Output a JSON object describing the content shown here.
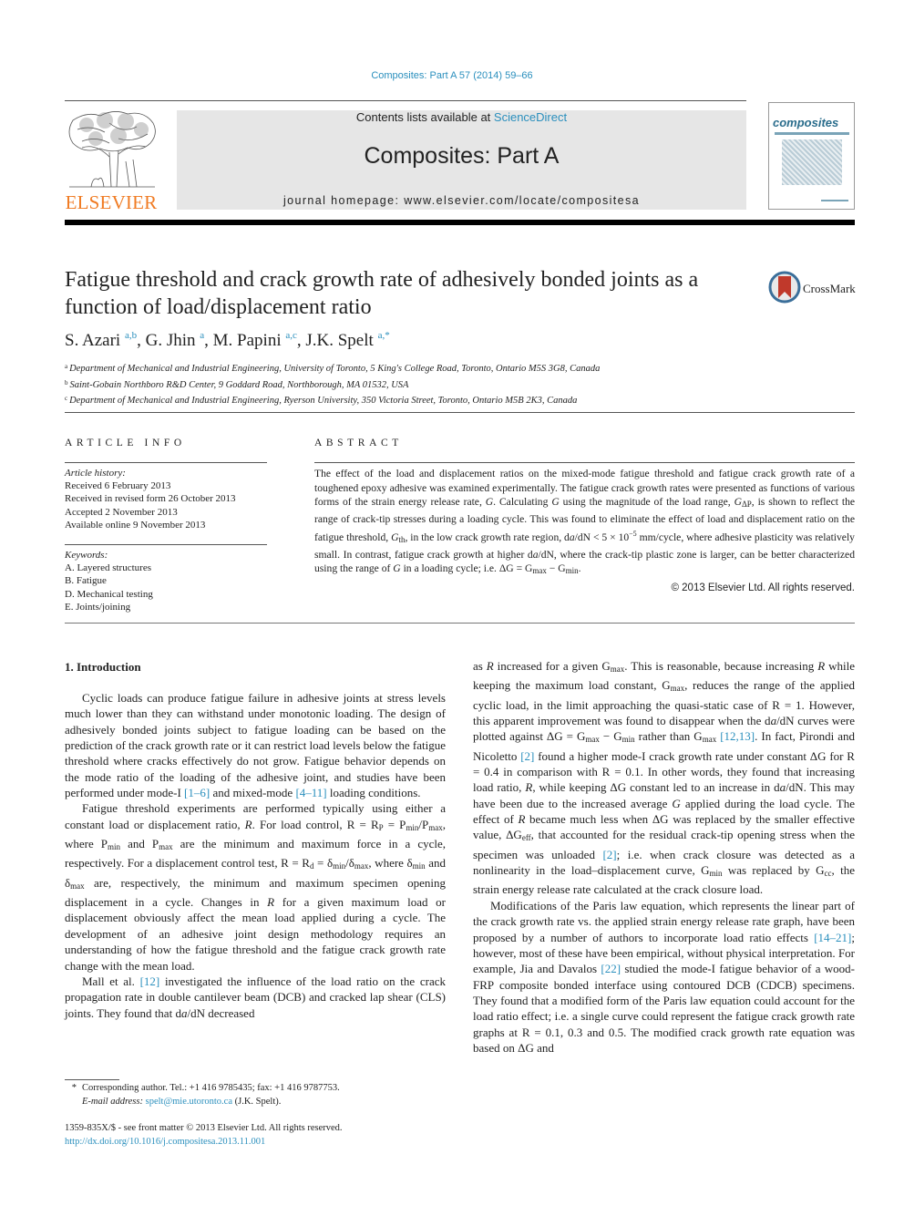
{
  "header": {
    "citation": "Composites: Part A 57 (2014) 59–66",
    "contents_prefix": "Contents lists available at ",
    "contents_link": "ScienceDirect",
    "journal_name": "Composites: Part A",
    "homepage": "journal homepage: www.elsevier.com/locate/compositesa",
    "publisher_logo_text": "ELSEVIER",
    "cover_title": "composites",
    "colors": {
      "link": "#2a8fbd",
      "elsevier_orange": "#f07b23",
      "masthead_bg": "#e6e6e6"
    }
  },
  "article": {
    "title": "Fatigue threshold and crack growth rate of adhesively bonded joints as a function of load/displacement ratio",
    "crossmark_label": "CrossMark",
    "authors": [
      {
        "name": "S. Azari",
        "affil": "a,b"
      },
      {
        "name": "G. Jhin",
        "affil": "a"
      },
      {
        "name": "M. Papini",
        "affil": "a,c"
      },
      {
        "name": "J.K. Spelt",
        "affil": "a,*"
      }
    ],
    "affiliations": [
      {
        "key": "a",
        "text": "Department of Mechanical and Industrial Engineering, University of Toronto, 5 King's College Road, Toronto, Ontario M5S 3G8, Canada"
      },
      {
        "key": "b",
        "text": "Saint-Gobain Northboro R&D Center, 9 Goddard Road, Northborough, MA 01532, USA"
      },
      {
        "key": "c",
        "text": "Department of Mechanical and Industrial Engineering, Ryerson University, 350 Victoria Street, Toronto, Ontario M5B 2K3, Canada"
      }
    ]
  },
  "article_info": {
    "heading": "ARTICLE INFO",
    "history_label": "Article history:",
    "history": [
      "Received 6 February 2013",
      "Received in revised form 26 October 2013",
      "Accepted 2 November 2013",
      "Available online 9 November 2013"
    ],
    "keywords_label": "Keywords:",
    "keywords": [
      "A. Layered structures",
      "B. Fatigue",
      "D. Mechanical testing",
      "E. Joints/joining"
    ]
  },
  "abstract": {
    "heading": "ABSTRACT",
    "s1": "The effect of the load and displacement ratios on the mixed-mode fatigue threshold and fatigue crack growth rate of a toughened epoxy adhesive was examined experimentally. The fatigue crack growth rates were presented as functions of various forms of the strain energy release rate, ",
    "s2": ". Calculating ",
    "s3": " using the magnitude of the load range, ",
    "s4": ", is shown to reflect the range of crack-tip stresses during a loading cycle. This was found to eliminate the effect of load and displacement ratio on the fatigue threshold, ",
    "s5": ", in the low crack growth rate region, d",
    "s6": " < 5 × 10",
    "exp": "−5",
    "s7": " mm/cycle, where adhesive plasticity was relatively small. In contrast, fatigue crack growth at higher d",
    "s8": ", where the crack-tip plastic zone is larger, can be better characterized using the range of ",
    "s9": " in a loading cycle; i.e. ΔG = G",
    "s10": " − G",
    "copyright": "© 2013 Elsevier Ltd. All rights reserved."
  },
  "body": {
    "section_heading": "1. Introduction",
    "p1a": "Cyclic loads can produce fatigue failure in adhesive joints at stress levels much lower than they can withstand under monotonic loading. The design of adhesively bonded joints subject to fatigue loading can be based on the prediction of the crack growth rate or it can restrict load levels below the fatigue threshold where cracks effectively do not grow. Fatigue behavior depends on the mode ratio of the loading of the adhesive joint, and studies have been performed under mode-I ",
    "ref_1_6": "[1–6]",
    "p1b": " and mixed-mode ",
    "ref_4_11": "[4–11]",
    "p1c": " loading conditions.",
    "p2a": "Fatigue threshold experiments are performed typically using either a constant load or displacement ratio, ",
    "p2b": ". For load control, R = R",
    "p2c": " = P",
    "p2d": "/P",
    "p2e": ", where P",
    "p2f": " and P",
    "p2g": " are the minimum and maximum force in a cycle, respectively. For a displacement control test, R = R",
    "p2h": " = δ",
    "p2i": "/δ",
    "p2j": ", where δ",
    "p2k": " and δ",
    "p2l": " are, respectively, the minimum and maximum specimen opening displacement in a cycle. Changes in ",
    "p2m": " for a given maximum load or displacement obviously affect the mean load applied during a cycle. The development of an adhesive joint design methodology requires an understanding of how the fatigue threshold and the fatigue crack growth rate change with the mean load.",
    "p3a": "Mall et al. ",
    "ref_12": "[12]",
    "p3b": " investigated the influence of the load ratio on the crack propagation rate in double cantilever beam (DCB) and cracked lap shear (CLS) joints. They found that d",
    "p3c": " decreased",
    "r1a": "as ",
    "r1b": " increased for a given G",
    "r1c": ". This is reasonable, because increasing ",
    "r1d": " while keeping the maximum load constant, G",
    "r1e": ", reduces the range of the applied cyclic load, in the limit approaching the quasi-static case of R = 1. However, this apparent improvement was found to disappear when the d",
    "r1f": " curves were plotted against ΔG = G",
    "r1g": " − G",
    "r1h": " rather than G",
    "ref_12_13": "[12,13]",
    "r1i": ". In fact, Pirondi and Nicoletto ",
    "ref_2": "[2]",
    "r1j": " found a higher mode-I crack growth rate under constant ΔG for R = 0.4 in comparison with R = 0.1. In other words, they found that increasing load ratio, ",
    "r1k": ", while keeping ΔG constant led to an increase in d",
    "r1l": ". This may have been due to the increased average ",
    "r1m": " applied during the load cycle. The effect of ",
    "r1n": " became much less when ΔG was replaced by the smaller effective value, ΔG",
    "r1o": ", that accounted for the residual crack-tip opening stress when the specimen was unloaded ",
    "r1p": "; i.e. when crack closure was detected as a nonlinearity in the load–displacement curve, G",
    "r1q": " was replaced by G",
    "r1r": ", the strain energy release rate calculated at the crack closure load.",
    "r2a": "Modifications of the Paris law equation, which represents the linear part of the crack growth rate vs. the applied strain energy release rate graph, have been proposed by a number of authors to incorporate load ratio effects ",
    "ref_14_21": "[14–21]",
    "r2b": "; however, most of these have been empirical, without physical interpretation. For example, Jia and Davalos ",
    "ref_22": "[22]",
    "r2c": " studied the mode-I fatigue behavior of a wood-FRP composite bonded interface using contoured DCB (CDCB) specimens. They found that a modified form of the Paris law equation could account for the load ratio effect; i.e. a single curve could represent the fatigue crack growth rate graphs at R = 0.1, 0.3 and 0.5. The modified crack growth rate equation was based on ΔG and"
  },
  "footnote": {
    "star": "*",
    "line1": "Corresponding author. Tel.: +1 416 9785435; fax: +1 416 9787753.",
    "email_label": "E-mail address: ",
    "email": "spelt@mie.utoronto.ca",
    "email_suffix": " (J.K. Spelt)."
  },
  "issn": {
    "line": "1359-835X/$ - see front matter © 2013 Elsevier Ltd. All rights reserved.",
    "doi": "http://dx.doi.org/10.1016/j.compositesa.2013.11.001"
  },
  "symbols": {
    "G": "G",
    "R": "R",
    "a": "a",
    "N": "N",
    "dN": "/dN",
    "max": "max",
    "min": "min",
    "th": "th",
    "dp": "ΔP",
    "P": "P",
    "d": "d",
    "eff": "eff",
    "cc": "cc",
    "Gth": "G"
  }
}
